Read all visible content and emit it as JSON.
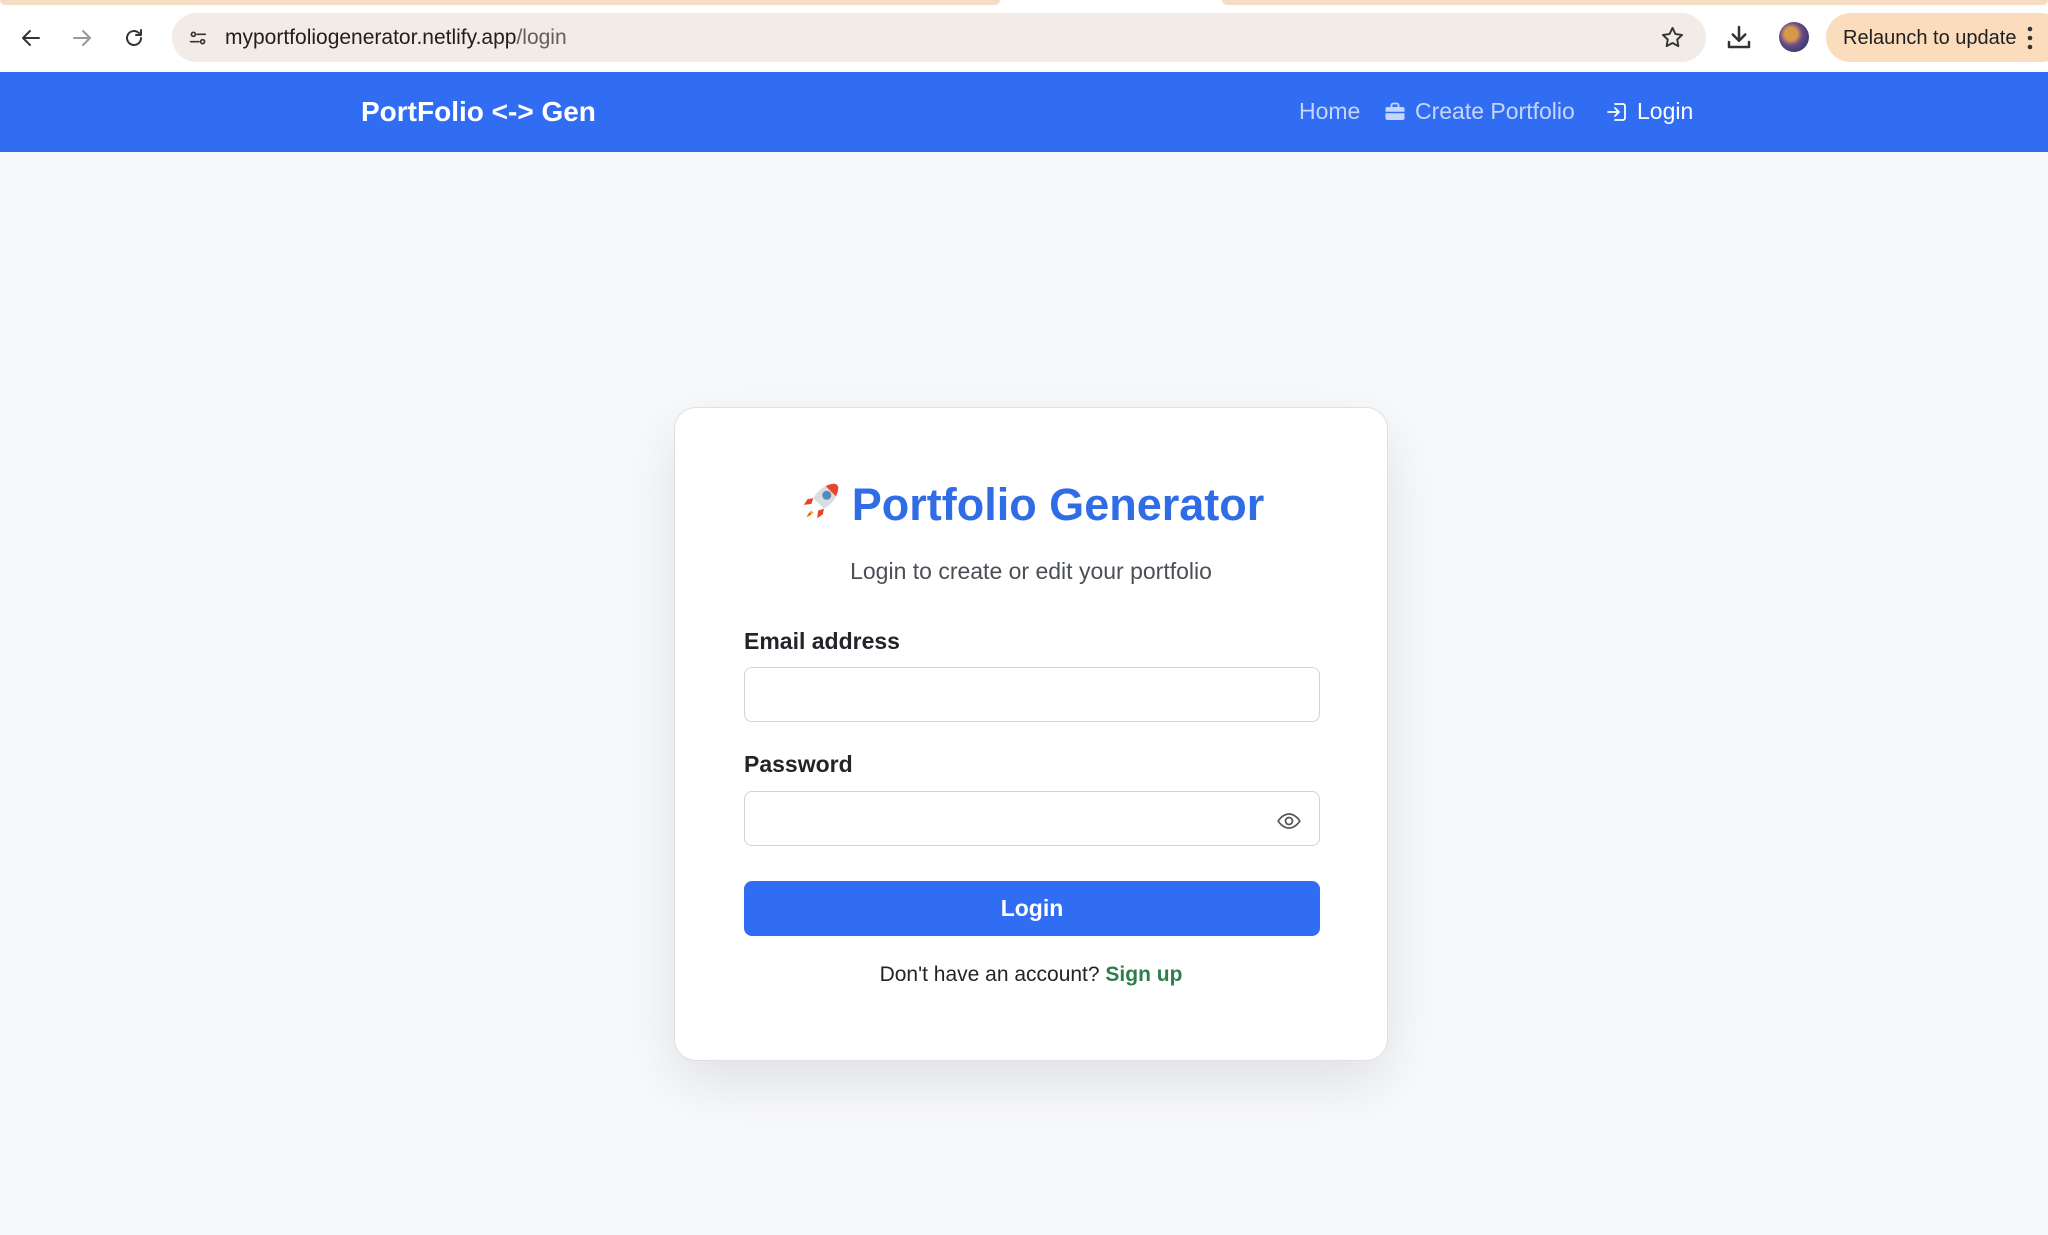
{
  "browser": {
    "url_host": "myportfoliogenerator.netlify.app",
    "url_path": "/login",
    "relaunch_label": "Relaunch to update"
  },
  "navbar": {
    "brand": "PortFolio <-> Gen",
    "links": [
      {
        "label": "Home",
        "icon": "",
        "active": false
      },
      {
        "label": "Create Portfolio",
        "icon": "briefcase-icon",
        "active": false
      },
      {
        "label": "Login",
        "icon": "login-icon",
        "active": true
      }
    ],
    "color": "#306df2"
  },
  "card": {
    "title": "Portfolio Generator",
    "title_icon": "rocket-icon",
    "subtitle": "Login to create or edit your portfolio",
    "email_label": "Email address",
    "email_value": "",
    "password_label": "Password",
    "password_value": "",
    "login_button": "Login",
    "signup_prompt": "Don't have an account?",
    "signup_link": "Sign up",
    "title_color": "#2f6ce5",
    "signup_color": "#2e7d4a"
  }
}
